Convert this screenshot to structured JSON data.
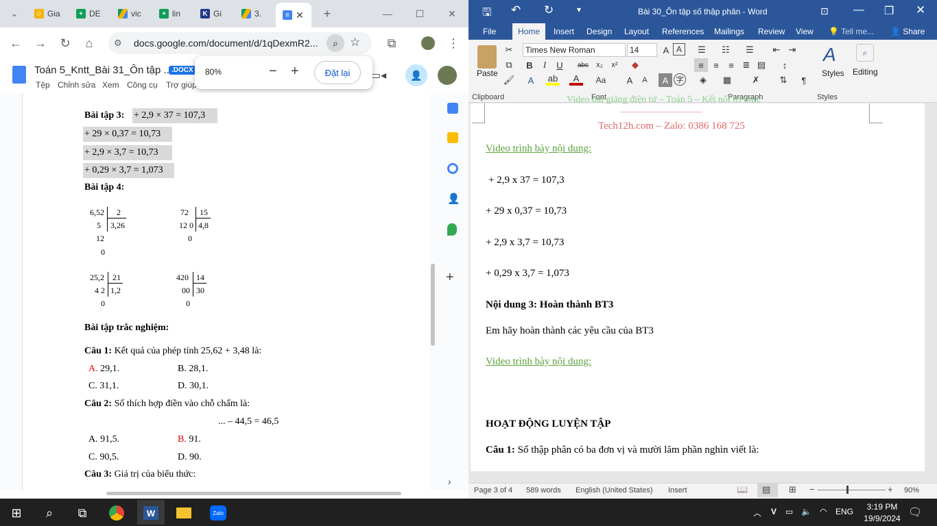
{
  "chrome": {
    "tabs": [
      "Gia",
      "DE",
      "vic",
      "lin",
      "Gi",
      "3.",
      ""
    ],
    "address": "docs.google.com/document/d/1qDexmR2...",
    "doc_title": "Toán 5_Kntt_Bài 31_Ôn tập ...",
    "doc_badge": ".DOCX",
    "menu": [
      "Tệp",
      "Chỉnh sửa",
      "Xem",
      "Công cụ",
      "Trợ giúp"
    ],
    "zoom_value": "80%",
    "zoom_reset": "Đặt lại",
    "content": {
      "bt3_label": "Bài tập 3:",
      "bt3_lines": [
        "+ 2,9 × 37 = 107,3",
        "+ 29 × 0,37 = 10,73",
        "+ 2,9 × 3,7 = 10,73",
        "+ 0,29 × 3,7 = 1,073"
      ],
      "bt4_label": "Bài tập 4:",
      "div1": {
        "a": "6,52",
        "b": "2",
        "r1": "5",
        "q": "3,26",
        "r2": "12",
        "r3": "0"
      },
      "div2": {
        "a": "72",
        "b": "15",
        "r1": "12 0",
        "q": "4,8",
        "r2": "0"
      },
      "div3": {
        "a": "25,2",
        "b": "21",
        "r1": "4 2",
        "q": "1,2",
        "r2": "0"
      },
      "div4": {
        "a": "420",
        "b": "14",
        "r1": "00",
        "q": "30",
        "r2": "0"
      },
      "quiz_title": "Bài tập trắc nghiệm:",
      "q1_label": "Câu 1:",
      "q1_text": "Kết quả của phép tính 25,62 + 3,48 là:",
      "q1_opts": {
        "a_letter": "A.",
        "a": "29,1.",
        "b": "B. 28,1.",
        "c": "C. 31,1.",
        "d": "D. 30,1."
      },
      "q2_label": "Câu 2:",
      "q2_text": "Số thích hợp điền vào chỗ chấm là:",
      "q2_expr": "... – 44,5 = 46,5",
      "q2_opts": {
        "a": "A. 91,5.",
        "b_letter": "B.",
        "b": "91.",
        "c": "C. 90,5.",
        "d": "D. 90."
      },
      "q3_label": "Câu 3:",
      "q3_text": "Giá trị của biểu thức:"
    }
  },
  "word": {
    "title": "Bài 30_Ôn tập số thập phân - Word",
    "tabs": [
      "File",
      "Home",
      "Insert",
      "Design",
      "Layout",
      "References",
      "Mailings",
      "Review",
      "View",
      "Tell me...",
      "Share"
    ],
    "font": "Times New Roman",
    "size": "14",
    "groups": [
      "Clipboard",
      "Font",
      "Paragraph",
      "Styles"
    ],
    "paste": "Paste",
    "styles_btn": "Styles",
    "editing_btn": "Editing",
    "page": {
      "header_top": "Video bài giảng điện tử – Toán 5 – Kết nối tri thức",
      "header_line": "----------------------------------------",
      "header_brand": "Tech12h.com – Zalo: 0386 168 725",
      "video1": "Video trình bày nội dung:",
      "lines": [
        "+ 2,9 x 37 = 107,3",
        "+ 29 x 0,37 = 10,73",
        "+ 2,9 x 3,7 = 10,73",
        "+ 0,29 x 3,7 = 1,073"
      ],
      "nd3": "Nội dung 3: Hoàn thành BT3",
      "nd3_text": "Em hãy hoàn thành các yêu cầu của BT3",
      "video2": "Video trình bày nội dung:",
      "activity": "HOẠT ĐỘNG LUYỆN TẬP",
      "cau1_label": "Câu 1:",
      "cau1_text": "Số thập phân có ba đơn vị và mười lăm phần nghìn viết là:"
    },
    "status": {
      "page": "Page 3 of 4",
      "words": "589 words",
      "lang": "English (United States)",
      "mode": "Insert",
      "zoom": "90%"
    }
  },
  "taskbar": {
    "lang": "ENG",
    "time": "3:19 PM",
    "date": "19/9/2024"
  }
}
